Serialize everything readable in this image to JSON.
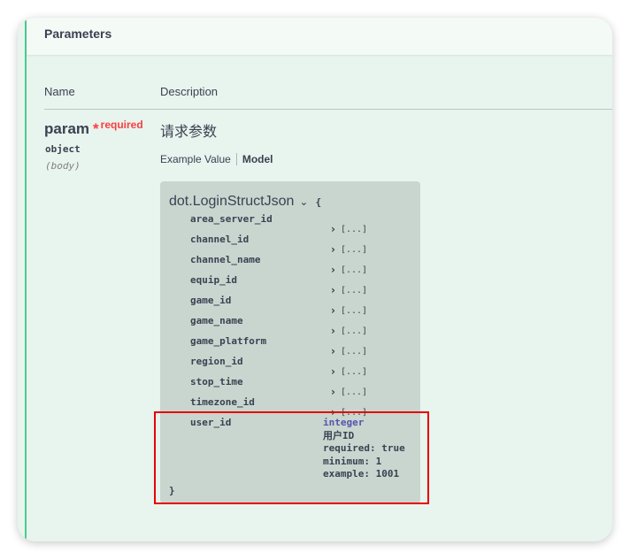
{
  "section": {
    "title": "Parameters"
  },
  "columns": {
    "name": "Name",
    "description": "Description"
  },
  "param": {
    "name": "param",
    "star": "*",
    "required_label": "required",
    "type": "object",
    "location": "(body)",
    "description": "请求参数"
  },
  "tabs": {
    "example_value": "Example Value",
    "model": "Model"
  },
  "model": {
    "title": "dot.LoginStructJson",
    "open_brace": "{",
    "close_brace": "}",
    "collapsed_value": "[...]",
    "properties": [
      {
        "name": "area_server_id"
      },
      {
        "name": "channel_id"
      },
      {
        "name": "channel_name"
      },
      {
        "name": "equip_id"
      },
      {
        "name": "game_id"
      },
      {
        "name": "game_name"
      },
      {
        "name": "game_platform"
      },
      {
        "name": "region_id"
      },
      {
        "name": "stop_time"
      },
      {
        "name": "timezone_id"
      }
    ],
    "expanded_property": {
      "name": "user_id",
      "type": "integer",
      "description": "用户ID",
      "required": "required: true",
      "minimum": "minimum: 1",
      "example": "example: 1001"
    }
  },
  "colors": {
    "accent": "#49cc90",
    "highlight": "#e60000",
    "required": "#f93e3e"
  }
}
